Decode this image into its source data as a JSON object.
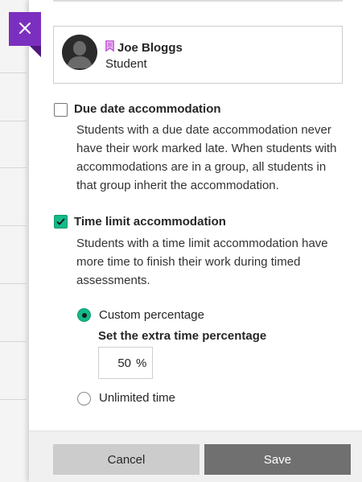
{
  "user": {
    "name": "Joe Bloggs",
    "role": "Student"
  },
  "accommodations": {
    "due_date": {
      "title": "Due date accommodation",
      "checked": false,
      "description_lines": [
        "Students with a due date accommodation never",
        "have their work marked late. When students with",
        "accommodations are in a group, all students in",
        "that group inherit the accommodation."
      ]
    },
    "time_limit": {
      "title": "Time limit accommodation",
      "checked": true,
      "description_lines": [
        "Students with a time limit accommodation have",
        "more time to finish their work during timed",
        "assessments."
      ],
      "options": {
        "custom_label": "Custom percentage",
        "custom_selected": true,
        "extra_time_heading": "Set the extra time percentage",
        "percentage_value": "50",
        "percentage_unit": "%",
        "unlimited_label": "Unlimited time",
        "unlimited_selected": false
      }
    }
  },
  "footer": {
    "cancel_label": "Cancel",
    "save_label": "Save"
  },
  "colors": {
    "accent_purple": "#7b2fbe",
    "check_green": "#13b988",
    "bookmark_pink": "#c04fd6"
  },
  "icons": {
    "close": "close-icon",
    "bookmark": "bookmark-icon",
    "avatar": "avatar-icon",
    "check": "check-icon"
  }
}
